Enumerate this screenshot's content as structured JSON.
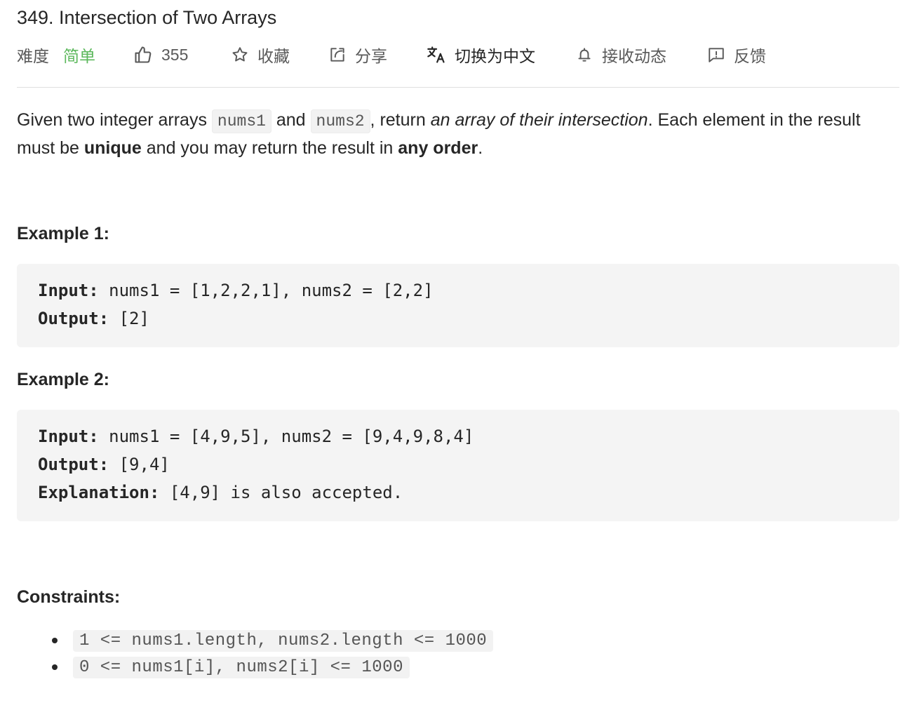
{
  "problem": {
    "title": "349. Intersection of Two Arrays"
  },
  "toolbar": {
    "difficulty_label": "难度",
    "difficulty_value": "简单",
    "likes": "355",
    "favorite_label": "收藏",
    "share_label": "分享",
    "translate_label": "切换为中文",
    "subscribe_label": "接收动态",
    "feedback_label": "反馈"
  },
  "colors": {
    "difficulty_easy": "#5cb85c",
    "text": "#262626",
    "muted": "#595959",
    "code_bg": "#f4f4f4"
  },
  "icons": {
    "likes": "thumbs-up-icon",
    "favorite": "star-icon",
    "share": "share-icon",
    "translate": "translate-icon",
    "subscribe": "bell-icon",
    "feedback": "feedback-icon"
  },
  "description": {
    "part1": "Given two integer arrays ",
    "code1": "nums1",
    "part2": " and ",
    "code2": "nums2",
    "part3": ", return ",
    "emphasis": "an array of their intersection",
    "part4": ". Each element in the result must be ",
    "bold1": "unique",
    "part5": " and you may return the result in ",
    "bold2": "any order",
    "part6": "."
  },
  "examples": [
    {
      "heading": "Example 1:",
      "input_label": "Input:",
      "input_value": " nums1 = [1,2,2,1], nums2 = [2,2]",
      "output_label": "Output:",
      "output_value": " [2]"
    },
    {
      "heading": "Example 2:",
      "input_label": "Input:",
      "input_value": " nums1 = [4,9,5], nums2 = [9,4,9,8,4]",
      "output_label": "Output:",
      "output_value": " [9,4]",
      "explanation_label": "Explanation:",
      "explanation_value": " [4,9] is also accepted."
    }
  ],
  "constraints": {
    "heading": "Constraints:",
    "items": [
      "1 <= nums1.length, nums2.length <= 1000",
      "0 <= nums1[i], nums2[i] <= 1000"
    ]
  }
}
